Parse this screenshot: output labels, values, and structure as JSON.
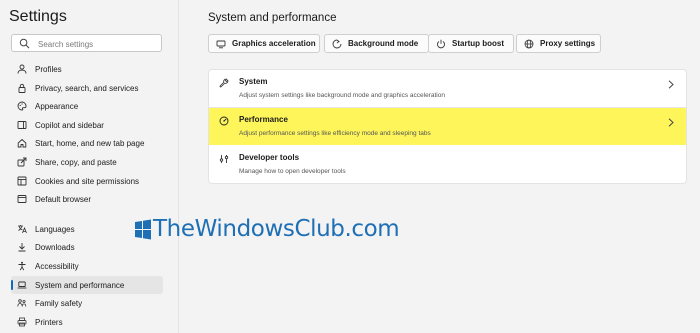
{
  "sidebar": {
    "title": "Settings",
    "search_placeholder": "Search settings",
    "items": [
      {
        "label": "Profiles",
        "icon": "profile-icon"
      },
      {
        "label": "Privacy, search, and services",
        "icon": "lock-icon"
      },
      {
        "label": "Appearance",
        "icon": "palette-icon"
      },
      {
        "label": "Copilot and sidebar",
        "icon": "sidebar-icon"
      },
      {
        "label": "Start, home, and new tab page",
        "icon": "home-icon"
      },
      {
        "label": "Share, copy, and paste",
        "icon": "share-icon"
      },
      {
        "label": "Cookies and site permissions",
        "icon": "cookie-icon"
      },
      {
        "label": "Default browser",
        "icon": "browser-icon"
      },
      {
        "label": "Languages",
        "icon": "language-icon"
      },
      {
        "label": "Downloads",
        "icon": "download-icon"
      },
      {
        "label": "Accessibility",
        "icon": "accessibility-icon"
      },
      {
        "label": "System and performance",
        "icon": "laptop-icon",
        "active": true
      },
      {
        "label": "Family safety",
        "icon": "family-icon"
      },
      {
        "label": "Printers",
        "icon": "printer-icon"
      }
    ]
  },
  "main": {
    "title": "System and performance",
    "chips": [
      {
        "label": "Graphics acceleration",
        "icon": "display-icon"
      },
      {
        "label": "Background mode",
        "icon": "background-icon"
      },
      {
        "label": "Startup boost",
        "icon": "power-icon"
      },
      {
        "label": "Proxy settings",
        "icon": "globe-icon"
      }
    ],
    "rows": [
      {
        "title": "System",
        "description": "Adjust system settings like background mode and graphics acceleration",
        "icon": "wrench-icon"
      },
      {
        "title": "Performance",
        "description": "Adjust performance settings like efficiency mode and sleeping tabs",
        "icon": "speedometer-icon",
        "highlighted": true
      },
      {
        "title": "Developer tools",
        "description": "Manage how to open developer tools",
        "icon": "tools-icon"
      }
    ]
  },
  "watermark": {
    "text": "TheWindowsClub.com"
  },
  "colors": {
    "accent": "#0f6cbd",
    "highlight": "#fdf55a",
    "watermark": "#1f6fb5"
  }
}
